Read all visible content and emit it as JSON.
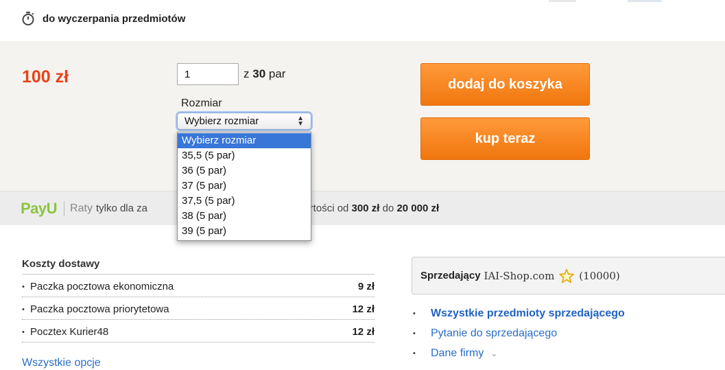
{
  "timer": {
    "text": "do wyczerpania przedmiotów",
    "icon": "stopwatch-icon"
  },
  "buy": {
    "price": "100 zł",
    "quantity_value": "1",
    "of_prefix": "z",
    "of_total": "30",
    "of_unit": "par",
    "size_label": "Rozmiar",
    "size_selected": "Wybierz rozmiar",
    "size_options": [
      "Wybierz rozmiar",
      "35,5 (5 par)",
      "36 (5 par)",
      "37 (5 par)",
      "37,5 (5 par)",
      "38 (5 par)",
      "39 (5 par)"
    ],
    "add_to_cart_label": "dodaj do koszyka",
    "buy_now_label": "kup teraz",
    "accent_color": "#f58220",
    "price_color": "#e8421b"
  },
  "payu": {
    "logo_text": "Pay",
    "logo_mark": "U",
    "raty": "Raty",
    "text_a": "tylko dla za",
    "text_b": "o wartości od",
    "min_amount": "300 zł",
    "text_c": "do",
    "max_amount": "20 000 zł",
    "brand_color": "#8bc53f"
  },
  "delivery": {
    "title": "Koszty dostawy",
    "rows": [
      {
        "name": "Paczka pocztowa ekonomiczna",
        "cost": "9 zł"
      },
      {
        "name": "Paczka pocztowa priorytetowa",
        "cost": "12 zł"
      },
      {
        "name": "Pocztex Kurier48",
        "cost": "12 zł"
      }
    ],
    "all_options": "Wszystkie opcje"
  },
  "seller": {
    "label": "Sprzedający",
    "name": "IAI-Shop.com",
    "rating_count": "(10000)",
    "links": [
      {
        "text": "Wszystkie przedmioty sprzedającego"
      },
      {
        "text": "Pytanie do sprzedającego"
      },
      {
        "text": "Dane firmy"
      }
    ]
  }
}
